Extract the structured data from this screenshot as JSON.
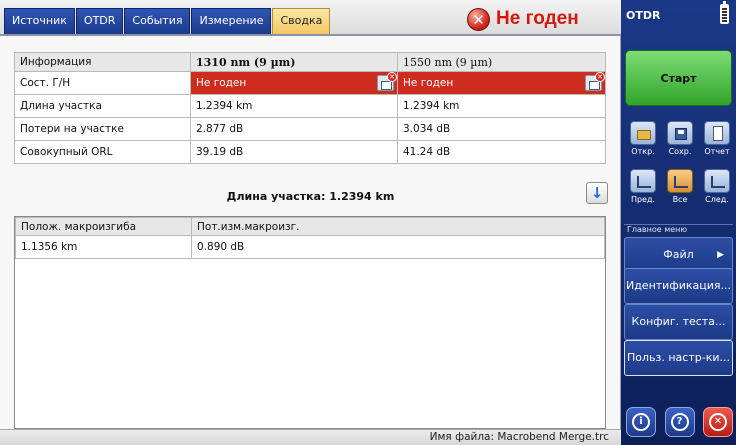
{
  "tabs": [
    "Источник",
    "OTDR",
    "События",
    "Измерение",
    "Сводка"
  ],
  "active_tab": "Сводка",
  "verdict": {
    "text": "Не годен",
    "color": "#d4190f"
  },
  "summary_table": {
    "headers": [
      "Информация",
      "1310 nm (9 µm)",
      "1550 nm (9 µm)"
    ],
    "rows": [
      {
        "label": "Сост. Г/Н",
        "v1310": "Не годен",
        "v1550": "Не годен"
      },
      {
        "label": "Длина участка",
        "v1310": "1.2394 km",
        "v1550": "1.2394 km"
      },
      {
        "label": "Потери на участке",
        "v1310": "2.877 dB",
        "v1550": "3.034 dB"
      },
      {
        "label": "Совокупный ORL",
        "v1310": "39.19 dB",
        "v1550": "41.24 dB"
      }
    ]
  },
  "span_length": "Длина участка: 1.2394 km",
  "macrobend_table": {
    "headers": [
      "Полож. макроизгиба",
      "Пот.изм.макроизг."
    ],
    "rows": [
      {
        "position": "1.1356 km",
        "loss": "0.890 dB"
      }
    ]
  },
  "status_bar": {
    "filename": "Имя файла: Macrobend  Merge.trc"
  },
  "sidebar": {
    "title": "OTDR",
    "start": "Старт",
    "file_buttons": [
      {
        "label": "Откр.",
        "icon": "open-folder-icon"
      },
      {
        "label": "Сохр.",
        "icon": "save-disk-icon"
      },
      {
        "label": "Отчет",
        "icon": "report-icon"
      }
    ],
    "nav_buttons": [
      {
        "label": "Пред.",
        "icon": "previous-trace-icon"
      },
      {
        "label": "Все",
        "icon": "all-traces-icon"
      },
      {
        "label": "След.",
        "icon": "next-trace-icon"
      }
    ],
    "menu_title": "Главное меню",
    "menu": [
      "Файл",
      "Идентификация...",
      "Конфиг. теста...",
      "Польз. настр-ки..."
    ],
    "bottom_icons": [
      "info-icon",
      "help-icon",
      "close-icon"
    ],
    "colors": {
      "panel": "#1b3888",
      "start": "#30a52a",
      "fail": "#cf2c20"
    }
  }
}
